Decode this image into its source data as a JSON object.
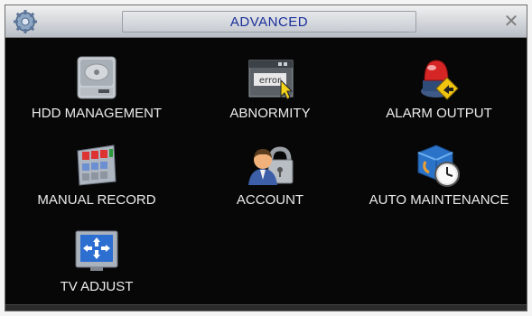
{
  "window": {
    "title": "ADVANCED"
  },
  "icons": {
    "settings": "gear-icon",
    "close": "close-icon",
    "hdd_management": "hard-disk-icon",
    "abnormity": "error-window-icon",
    "alarm_output": "alarm-light-icon",
    "manual_record": "record-panel-icon",
    "account": "user-lock-icon",
    "auto_maintenance": "maintenance-clock-icon",
    "tv_adjust": "tv-arrows-icon"
  },
  "close_glyph": "✕",
  "menu": {
    "items": [
      {
        "label": "HDD MANAGEMENT"
      },
      {
        "label": "ABNORMITY"
      },
      {
        "label": "ALARM OUTPUT"
      },
      {
        "label": "MANUAL RECORD"
      },
      {
        "label": "ACCOUNT"
      },
      {
        "label": "AUTO MAINTENANCE"
      },
      {
        "label": "TV ADJUST"
      }
    ]
  },
  "colors": {
    "title_text": "#1a2f9b",
    "background": "#070707",
    "label_text": "#ececec"
  }
}
